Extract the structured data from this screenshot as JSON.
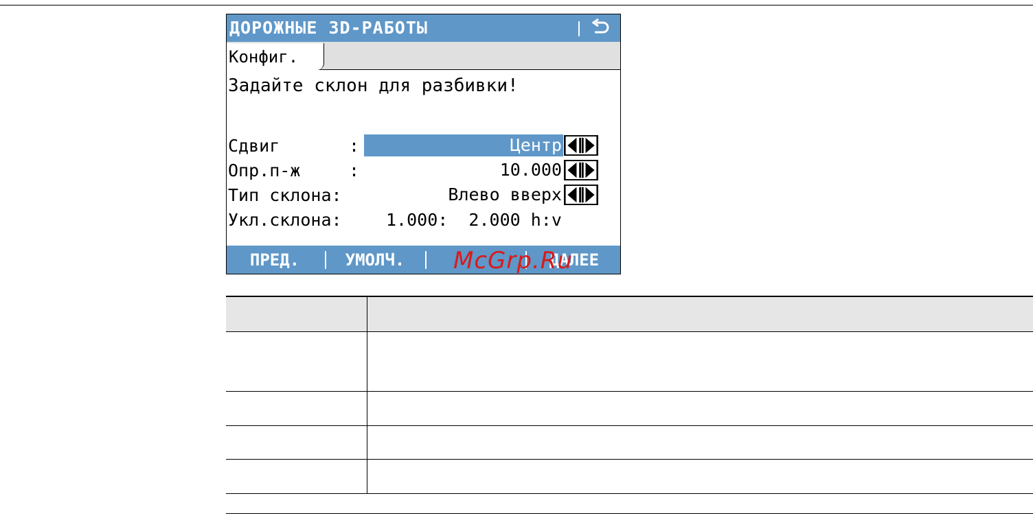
{
  "screen": {
    "title": "ДОРОЖНЫЕ 3D-РАБОТЫ",
    "tab": "Конфиг.",
    "prompt": "Задайте склон для разбивки!",
    "fields": [
      {
        "label": "Сдвиг",
        "colon": ":",
        "value": "Центр"
      },
      {
        "label": "Опр.п-ж",
        "colon": ":",
        "value": "10.000"
      },
      {
        "label": "Тип склона:",
        "colon": "",
        "value": "Влево вверх"
      }
    ],
    "slope": {
      "label": "Укл.склона:",
      "value": "1.000:  2.000 h:v"
    },
    "softkeys": [
      "ПРЕД.",
      "УМОЛЧ.",
      "",
      "ДАЛЕЕ"
    ],
    "watermark": "McGrp.Ru",
    "icons": {
      "back": "return-arrow-icon",
      "selector": "left-right-arrows-icon"
    },
    "colors": {
      "accent": "#5f97c8",
      "tab_bg": "#e0e0e0",
      "watermark": "#d81b1b"
    }
  },
  "table": {
    "header": [
      "",
      ""
    ],
    "rows": [
      [
        "",
        ""
      ],
      [
        "",
        ""
      ],
      [
        "",
        ""
      ],
      [
        "",
        ""
      ]
    ]
  }
}
